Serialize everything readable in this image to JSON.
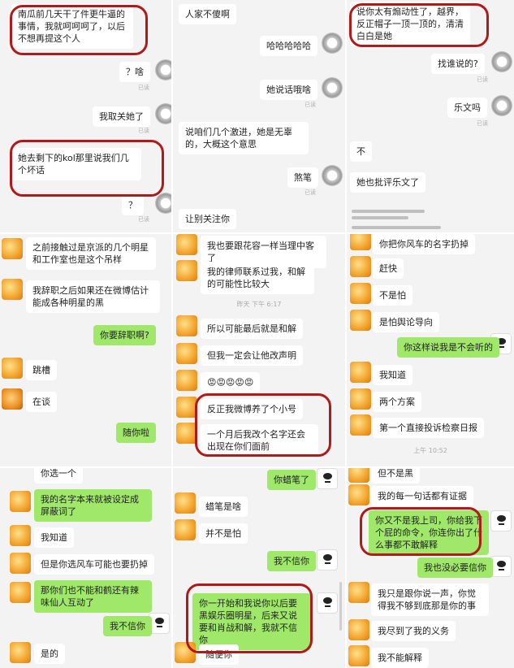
{
  "read_label": "已读",
  "p1": {
    "m1": "南瓜前几天干了件更牛逼的事情，我就呵呵呵了，以后不想再提这个人",
    "m2": "？啥",
    "m3": "我取关她了",
    "m4": "她去剩下的kol那里说我们几个坏话",
    "m5": "？"
  },
  "p2": {
    "m1": "人家不傻啊",
    "m2": "哈哈哈哈哈",
    "m3": "她说话哦啥",
    "m4": "说咱们几个激进，她是无辜的，大概这个意思",
    "m5": "煞笔",
    "m6": "让别关注你"
  },
  "p3": {
    "m1": "说你太有煽动性了，越界，反正帽子一顶一顶的，清清白白是她",
    "m2": "找谁说的?",
    "m3": "乐文吗",
    "m4": "不",
    "m5": "她也批评乐文了"
  },
  "p4": {
    "m1": "之前接触过是京派的几个明星和工作室也是这个吊样",
    "m2": "我辞职之后如果还在微博估计能成各种明星的黑",
    "m3": "你要辞职啊?",
    "m4": "跳槽",
    "m5": "在谈",
    "m6": "随你啦"
  },
  "p5": {
    "m1": "我也要跟花容一样当理中客了",
    "m2": "我的律师联系过我，和解的可能性比较大",
    "time": "昨天 下午 6:17",
    "m3": "所以可能最后就是和解",
    "m4": "但我一定会让他改声明",
    "m5": "😡😡😡😡😡",
    "m6": "反正我微博养了个小号",
    "m7": "一个月后我改个名字还会出现在你们面前"
  },
  "p6": {
    "m1": "你把你风车的名字扔掉",
    "m2": "赶快",
    "m3": "不是怕",
    "m4": "是怕舆论导向",
    "m5": "你这样说我是不会听的",
    "m6": "我知道",
    "m7": "两个方案",
    "m8": "第一个直接投诉检察日报",
    "time": "上午 10:52"
  },
  "p7": {
    "m1": "你选一个",
    "m2": "我的名字本来就被设定成屏蔽词了",
    "m3": "我知道",
    "m4": "但是你选风车可能也要扔掉",
    "m5": "那你们也不能和鹤还有辣味仙人互动了",
    "m6": "我不信你",
    "m7": "是的"
  },
  "p8": {
    "m1": "你蜡笔了",
    "m2": "蜡笔是啥",
    "m3": "并不是怕",
    "m4": "我不信你",
    "m5": "你一开始和我说你以后要黑娱乐圈明星，后来又说要和肖战和解，我就不信你",
    "m6": "随便你"
  },
  "p9": {
    "m1": "但不是黑",
    "m2": "我的每一句话都有证据",
    "m3": "你又不是我上司，你给我下个屁的命令，你连你出了什么事都不敢解释",
    "m4": "我也没必要信你",
    "m5": "我只是跟你说一声，你觉得我不够到底那是你的事",
    "m6": "我尽到了我的义务",
    "m7": "我不能解释"
  },
  "colors": {
    "sent_bubble": "#9fe86a",
    "received_bubble": "#ffffff",
    "highlight_circle": "#b01a1a"
  }
}
